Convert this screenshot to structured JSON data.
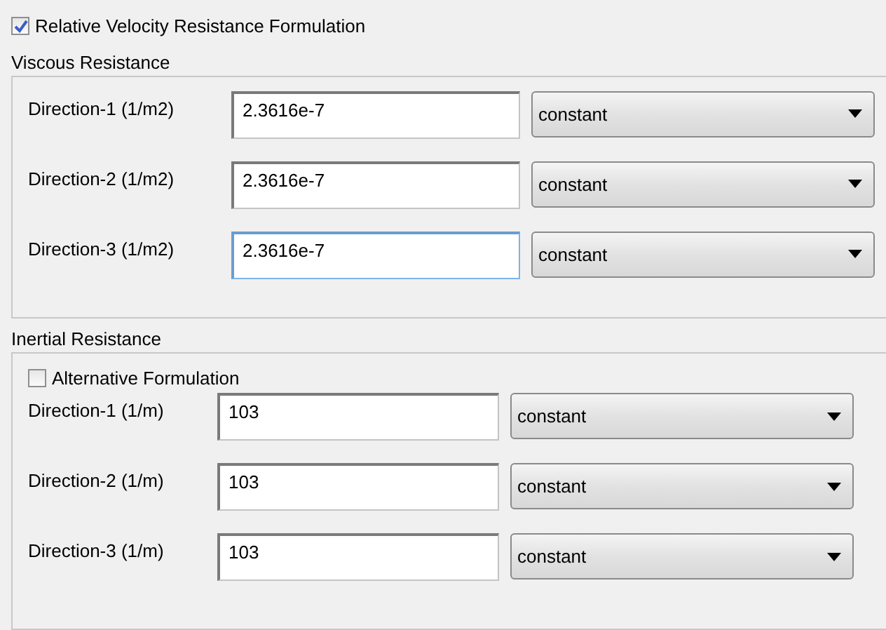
{
  "relative_velocity": {
    "label": "Relative Velocity Resistance Formulation",
    "checked": true
  },
  "viscous_resistance": {
    "title": "Viscous Resistance",
    "rows": [
      {
        "label": "Direction-1 (1/m2)",
        "value": "2.3616e-7",
        "focused": false,
        "method": "constant"
      },
      {
        "label": "Direction-2 (1/m2)",
        "value": "2.3616e-7",
        "focused": false,
        "method": "constant"
      },
      {
        "label": "Direction-3 (1/m2)",
        "value": "2.3616e-7",
        "focused": true,
        "method": "constant"
      }
    ]
  },
  "inertial_resistance": {
    "title": "Inertial Resistance",
    "alternative": {
      "label": "Alternative Formulation",
      "checked": false
    },
    "rows": [
      {
        "label": "Direction-1 (1/m)",
        "value": "103",
        "focused": false,
        "method": "constant"
      },
      {
        "label": "Direction-2 (1/m)",
        "value": "103",
        "focused": false,
        "method": "constant"
      },
      {
        "label": "Direction-3 (1/m)",
        "value": "103",
        "focused": false,
        "method": "constant"
      }
    ]
  }
}
